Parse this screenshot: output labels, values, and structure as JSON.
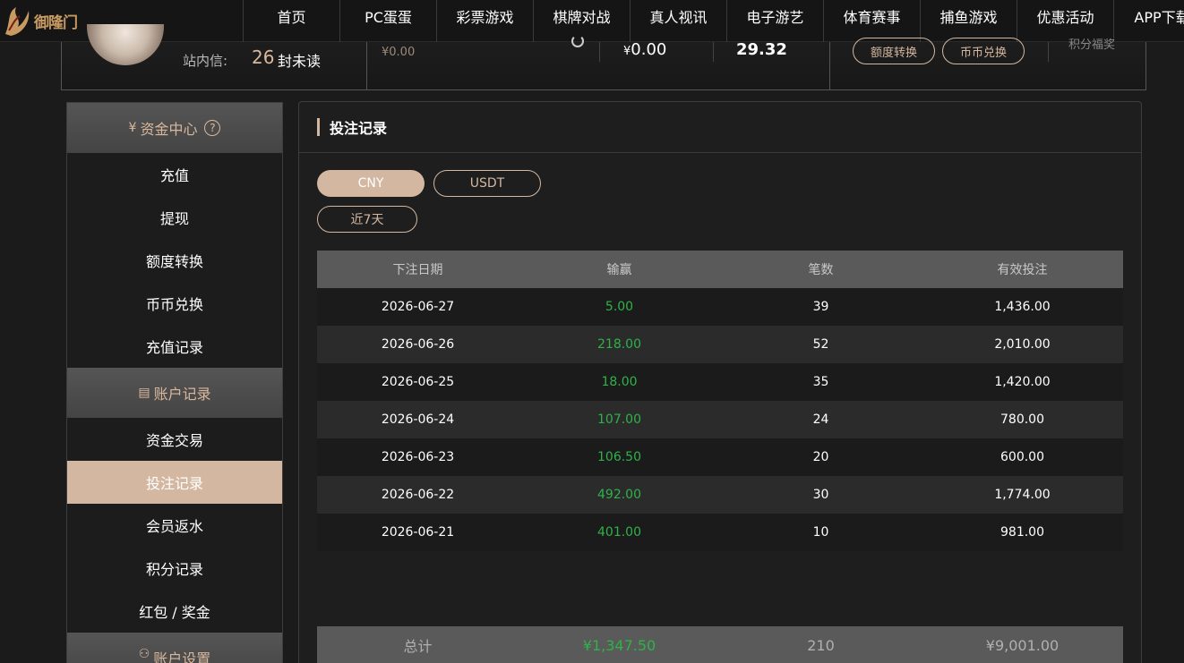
{
  "logo": {
    "text": "御隆门"
  },
  "nav": {
    "items": [
      "首页",
      "PC蛋蛋",
      "彩票游戏",
      "棋牌对战",
      "真人视讯",
      "电子游艺",
      "体育赛事",
      "捕鱼游戏",
      "优惠活动",
      "APP下载"
    ]
  },
  "summary": {
    "msg_label": "站内信:",
    "msg_count": "26",
    "msg_unread": "封未读",
    "small_amount": "¥0.00",
    "amount_currency": "¥",
    "amount_value": "0.00",
    "amount2": "29.32",
    "btn_transfer": "额度转换",
    "btn_exchange": "币币兑换",
    "points_label": "积分福奖"
  },
  "sidebar": {
    "group1_title": "资金中心",
    "group1_help": "?",
    "group1_items": [
      "充值",
      "提现",
      "额度转换",
      "币币兑换",
      "充值记录"
    ],
    "group2_title": "账户记录",
    "group2_items": [
      "资金交易",
      "投注记录",
      "会员返水",
      "积分记录",
      "红包 / 奖金"
    ],
    "group3_title": "账户设置",
    "active_item": "投注记录"
  },
  "panel": {
    "title": "投注记录",
    "tabs": [
      "CNY",
      "USDT"
    ],
    "active_tab": "CNY",
    "range": "近7天"
  },
  "table": {
    "headers": [
      "下注日期",
      "输赢",
      "笔数",
      "有效投注"
    ],
    "rows": [
      [
        "2026-06-27",
        "5.00",
        "39",
        "1,436.00"
      ],
      [
        "2026-06-26",
        "218.00",
        "52",
        "2,010.00"
      ],
      [
        "2026-06-25",
        "18.00",
        "35",
        "1,420.00"
      ],
      [
        "2026-06-24",
        "107.00",
        "24",
        "780.00"
      ],
      [
        "2026-06-23",
        "106.50",
        "20",
        "600.00"
      ],
      [
        "2026-06-22",
        "492.00",
        "30",
        "1,774.00"
      ],
      [
        "2026-06-21",
        "401.00",
        "10",
        "981.00"
      ]
    ],
    "footer": [
      "总计",
      "¥1,347.50",
      "210",
      "¥9,001.00"
    ]
  },
  "colors": {
    "accent": "#d4b7a0",
    "win_green": "#2fb24a",
    "background": "#1b1b1b"
  }
}
